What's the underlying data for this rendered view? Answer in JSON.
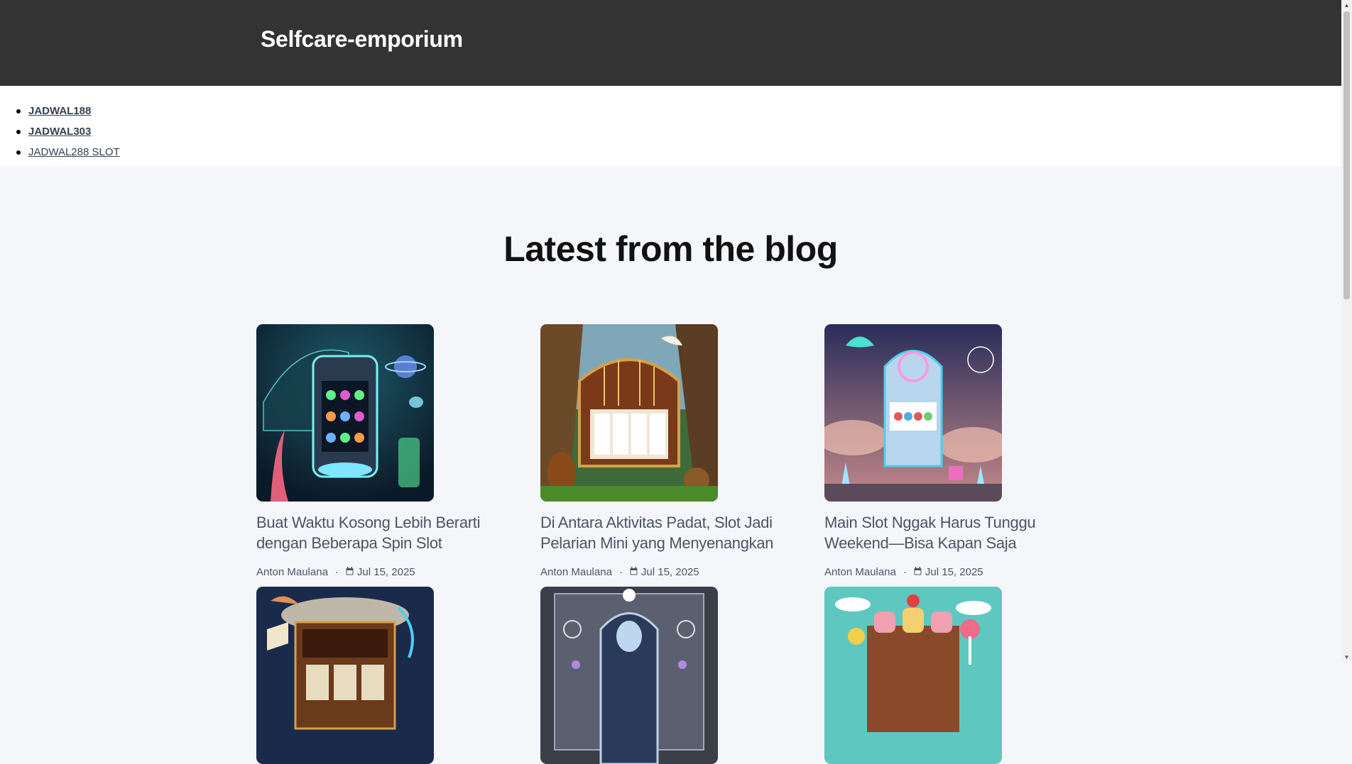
{
  "header": {
    "site_title": "Selfcare-emporium"
  },
  "nav": {
    "items": [
      {
        "label": "JADWAL188"
      },
      {
        "label": "JADWAL303"
      },
      {
        "label": "JADWAL288 SLOT"
      }
    ]
  },
  "blog": {
    "heading": "Latest from the blog",
    "posts": [
      {
        "title": "Buat Waktu Kosong Lebih Berarti dengan Beberapa Spin Slot",
        "author": "Anton Maulana",
        "date": "Jul 15, 2025",
        "image": "underwater-slot-machine"
      },
      {
        "title": "Di Antara Aktivitas Padat, Slot Jadi Pelarian Mini yang Menyenangkan",
        "author": "Anton Maulana",
        "date": "Jul 15, 2025",
        "image": "harp-slot-machine"
      },
      {
        "title": "Main Slot Nggak Harus Tunggu Weekend—Bisa Kapan Saja",
        "author": "Anton Maulana",
        "date": "Jul 15, 2025",
        "image": "crystal-slot-machine"
      },
      {
        "title": "",
        "author": "",
        "date": "",
        "image": "library-slot-machine"
      },
      {
        "title": "",
        "author": "",
        "date": "",
        "image": "snowflake-slot-machine"
      },
      {
        "title": "",
        "author": "",
        "date": "",
        "image": "candy-slot-machine"
      }
    ]
  },
  "meta": {
    "separator": "·",
    "calendar_icon": "calendar-icon"
  },
  "colors": {
    "header_bg": "#333333",
    "page_bg": "#f5f6f9",
    "nav_bg": "#ffffff"
  }
}
